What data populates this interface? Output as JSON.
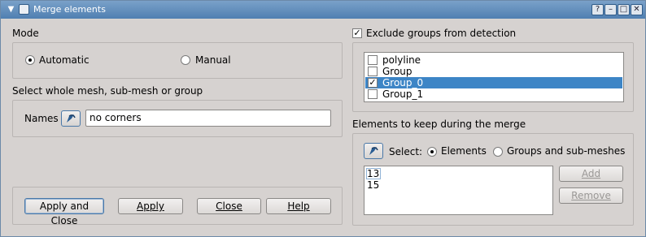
{
  "window": {
    "title": "Merge elements"
  },
  "mode": {
    "label": "Mode",
    "options": [
      "Automatic",
      "Manual"
    ],
    "selected": "Automatic"
  },
  "selection": {
    "label": "Select whole mesh, sub-mesh or group",
    "names_label": "Names",
    "names_value": "no corners"
  },
  "exclude": {
    "label": "Exclude groups from detection",
    "checked": true,
    "groups": [
      {
        "name": "polyline",
        "checked": false
      },
      {
        "name": "Group",
        "checked": false
      },
      {
        "name": "Group_0",
        "checked": true,
        "selected": true
      },
      {
        "name": "Group_1",
        "checked": false
      }
    ]
  },
  "keep": {
    "label": "Elements to keep during the merge",
    "select_label": "Select:",
    "options": [
      "Elements",
      "Groups and sub-meshes"
    ],
    "selected": "Elements",
    "items": [
      "13",
      "15"
    ],
    "add_label": "Add",
    "remove_label": "Remove"
  },
  "buttons": {
    "apply_close": "Apply and Close",
    "apply": "Apply",
    "close": "Close",
    "help": "Help"
  },
  "colors": {
    "titlebar": "#5b87b6",
    "selection": "#3d85c6"
  }
}
